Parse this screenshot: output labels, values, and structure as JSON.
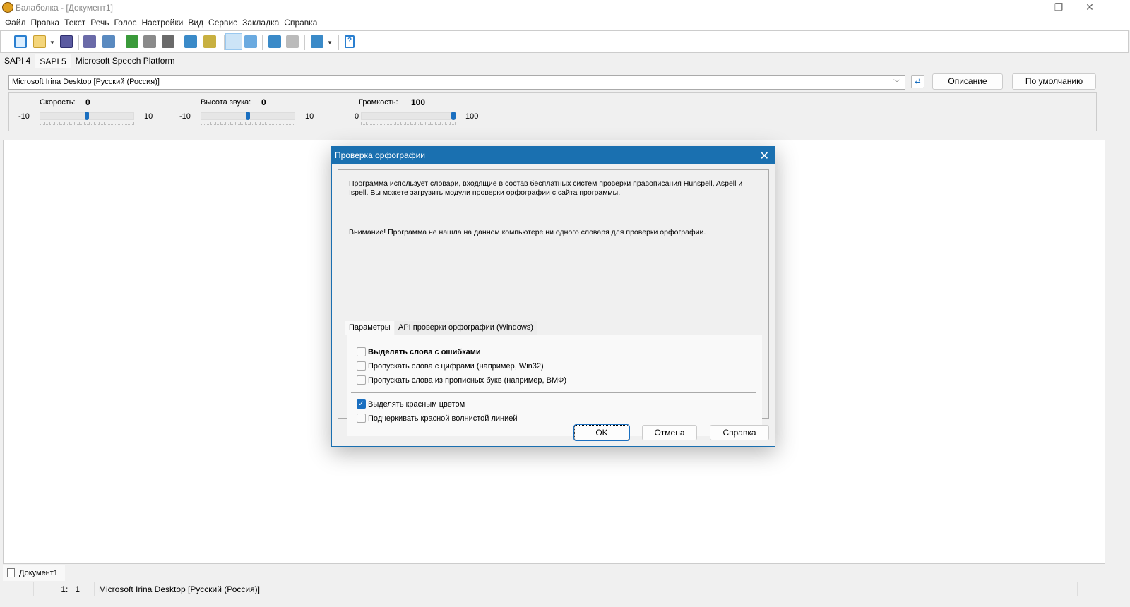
{
  "window": {
    "title": "Балаболка - [Документ1]",
    "minimize": "—",
    "maximize": "❐",
    "close": "✕"
  },
  "menu": [
    "Файл",
    "Правка",
    "Текст",
    "Речь",
    "Голос",
    "Настройки",
    "Вид",
    "Сервис",
    "Закладка",
    "Справка"
  ],
  "toolbar": [
    "new-document",
    "open",
    "save",
    "read-clipboard",
    "read-file",
    "play",
    "pause",
    "stop",
    "audio-file",
    "audio-folder",
    "text-view",
    "spell-view",
    "add-bookmark",
    "remove-bookmark",
    "bookmarks",
    "help"
  ],
  "engine_tabs": [
    "SAPI 4",
    "SAPI 5",
    "Microsoft Speech Platform"
  ],
  "voice": {
    "selected": "Microsoft Irina Desktop [Русский (Россия)]",
    "describe": "Описание",
    "default": "По умолчанию"
  },
  "sliders": [
    {
      "label": "Скорость:",
      "value": "0",
      "min": "-10",
      "max": "10",
      "fraction": 0.5
    },
    {
      "label": "Высота звука:",
      "value": "0",
      "min": "-10",
      "max": "10",
      "fraction": 0.5
    },
    {
      "label": "Громкость:",
      "value": "100",
      "min": "0",
      "max": "100",
      "fraction": 1.0
    }
  ],
  "doc_tab": "Документ1",
  "status": {
    "position": "1:   1",
    "voice": "Microsoft Irina Desktop [Русский (Россия)]"
  },
  "dialog": {
    "title": "Проверка орфографии",
    "info": "Программа использует словари, входящие в состав бесплатных систем проверки правописания Hunspell, Aspell и Ispell. Вы можете загрузить модули проверки орфографии с сайта программы.",
    "warning": "Внимание! Программа не нашла на данном компьютере ни одного словаря для проверки орфографии.",
    "tabs": [
      "Параметры",
      "API проверки орфографии (Windows)"
    ],
    "options": [
      {
        "label": "Выделять слова с ошибками",
        "checked": false
      },
      {
        "label": "Пропускать слова с цифрами (например, Win32)",
        "checked": false
      },
      {
        "label": "Пропускать слова из прописных букв (например, ВМФ)",
        "checked": false
      },
      {
        "label": "Выделять красным цветом",
        "checked": true
      },
      {
        "label": "Подчеркивать красной волнистой линией",
        "checked": false
      }
    ],
    "ok": "OK",
    "cancel": "Отмена",
    "help": "Справка"
  }
}
